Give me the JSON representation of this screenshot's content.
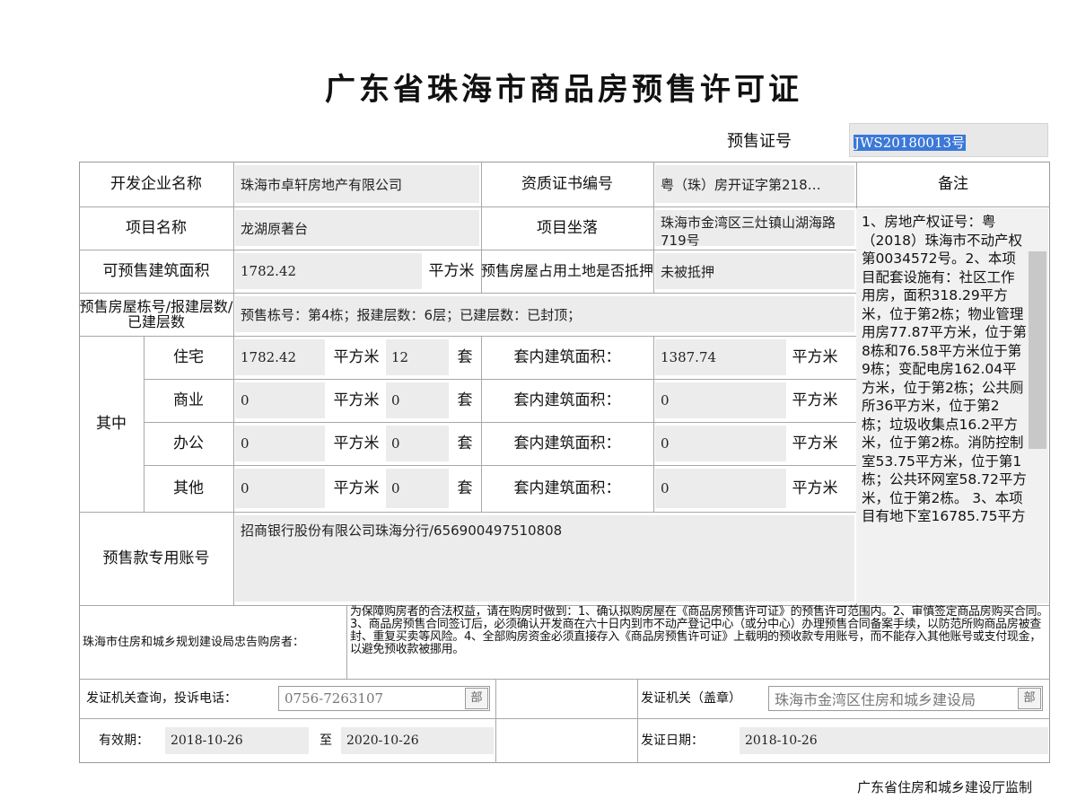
{
  "title": "广东省珠海市商品房预售许可证",
  "permit": {
    "label": "预售证号",
    "value": "JWS20180013号"
  },
  "row1": {
    "developer_label": "开发企业名称",
    "developer": "珠海市卓轩房地产有限公司",
    "qual_label": "资质证书编号",
    "qual": "粤（珠）房开证字第218…",
    "remarks_label": "备注"
  },
  "row2": {
    "project_label": "项目名称",
    "project": "龙湖原著台",
    "location_label": "项目坐落",
    "location": "珠海市金湾区三灶镇山湖海路719号"
  },
  "row3": {
    "area_label": "可预售建筑面积",
    "area": "1782.42",
    "unit": "平方米",
    "mortgage_label": "预售房屋占用土地是否抵押",
    "mortgage": "未被抵押"
  },
  "row4": {
    "label": "预售房屋栋号/报建层数/已建层数",
    "value": "预售栋号：第4栋；报建层数：6层；已建层数：已封顶；"
  },
  "breakdown": {
    "group_label": "其中",
    "unit_area": "平方米",
    "unit_count": "套",
    "inner_label": "套内建筑面积：",
    "rows": [
      {
        "type": "住宅",
        "area": "1782.42",
        "count": "12",
        "inner": "1387.74"
      },
      {
        "type": "商业",
        "area": "0",
        "count": "0",
        "inner": "0"
      },
      {
        "type": "办公",
        "area": "0",
        "count": "0",
        "inner": "0"
      },
      {
        "type": "其他",
        "area": "0",
        "count": "0",
        "inner": "0"
      }
    ]
  },
  "account": {
    "label": "预售款专用账号",
    "value": "招商银行股份有限公司珠海分行/656900497510808"
  },
  "remarks_text": "1、房地产权证号：粤（2018）珠海市不动产权第0034572号。2、本项目配套设施有：社区工作用房，面积318.29平方米，位于第2栋；物业管理用房77.87平方米，位于第8栋和76.58平方米位于第9栋；变配电房162.04平方米，位于第2栋；公共厕所36平方米，位于第2栋；垃圾收集点16.2平方米，位于第2栋。消防控制室53.75平方米，位于第1栋；公共环网室58.72平方米，位于第2栋。 3、本项目有地下室16785.75平方",
  "notice": {
    "label": "珠海市住房和城乡规划建设局忠告购房者：",
    "text": "为保障购房者的合法权益，请在购房时做到：1、确认拟购房屋在《商品房预售许可证》的预售许可范围内。2、审慎签定商品房购买合同。3、商品房预售合同签订后，必须确认开发商在六十日内到市不动产登记中心（或分中心）办理预售合同备案手续，以防范所购商品房被查封、重复买卖等风险。4、全部购房资金必须直接存入《商品房预售许可证》上载明的预收款专用账号，而不能存入其他账号或支付现金，以避免预收款被挪用。"
  },
  "contact": {
    "label": "发证机关查询，投诉电话：",
    "phone": "0756-7263107",
    "btn": "部",
    "issuer_label": "发证机关（盖章）",
    "issuer": "珠海市金湾区住房和城乡建设局",
    "issuer_btn": "部"
  },
  "validity": {
    "label": "有效期：",
    "from": "2018-10-26",
    "to_label": "至",
    "to": "2020-10-26",
    "date_label": "发证日期：",
    "date": "2018-10-26"
  },
  "footer": "广东省住房和城乡建设厅监制"
}
